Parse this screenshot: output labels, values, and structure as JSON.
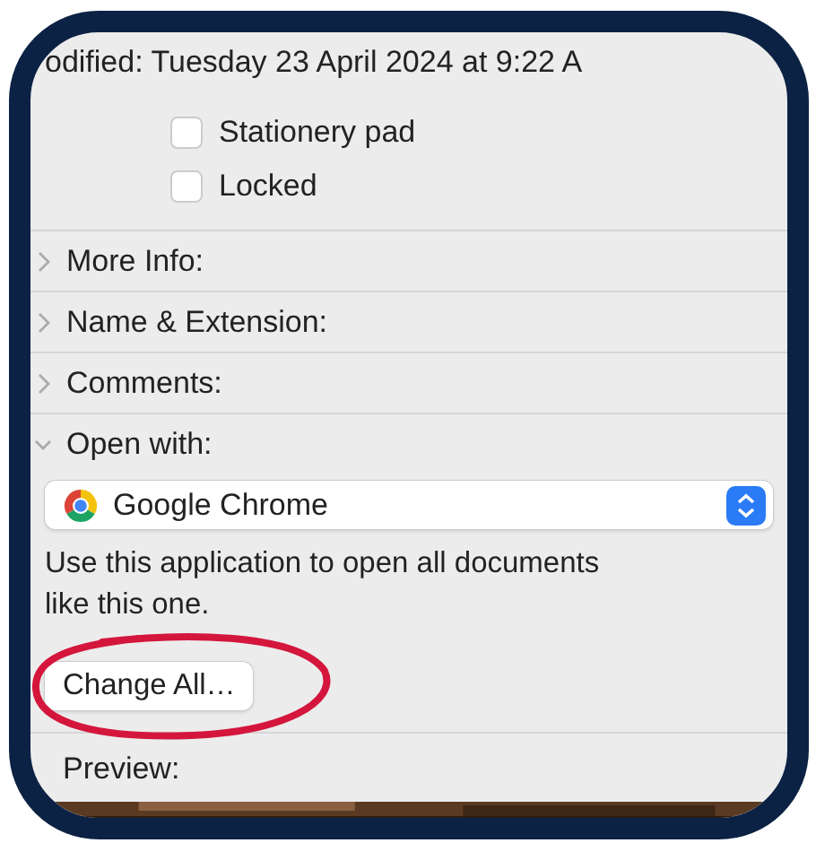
{
  "modified": "odified: Tuesday 23 April 2024 at 9:22 A",
  "checkboxes": [
    {
      "label": "Stationery pad",
      "checked": false
    },
    {
      "label": "Locked",
      "checked": false
    }
  ],
  "sections": [
    {
      "title": "More Info:",
      "expanded": false
    },
    {
      "title": "Name & Extension:",
      "expanded": false
    },
    {
      "title": "Comments:",
      "expanded": false
    },
    {
      "title": "Open with:",
      "expanded": true
    }
  ],
  "open_with": {
    "app": "Google Chrome",
    "description": "Use this application to open all documents like this one.",
    "button": "Change All…"
  },
  "preview": {
    "title": "Preview:",
    "kind": "picture"
  }
}
